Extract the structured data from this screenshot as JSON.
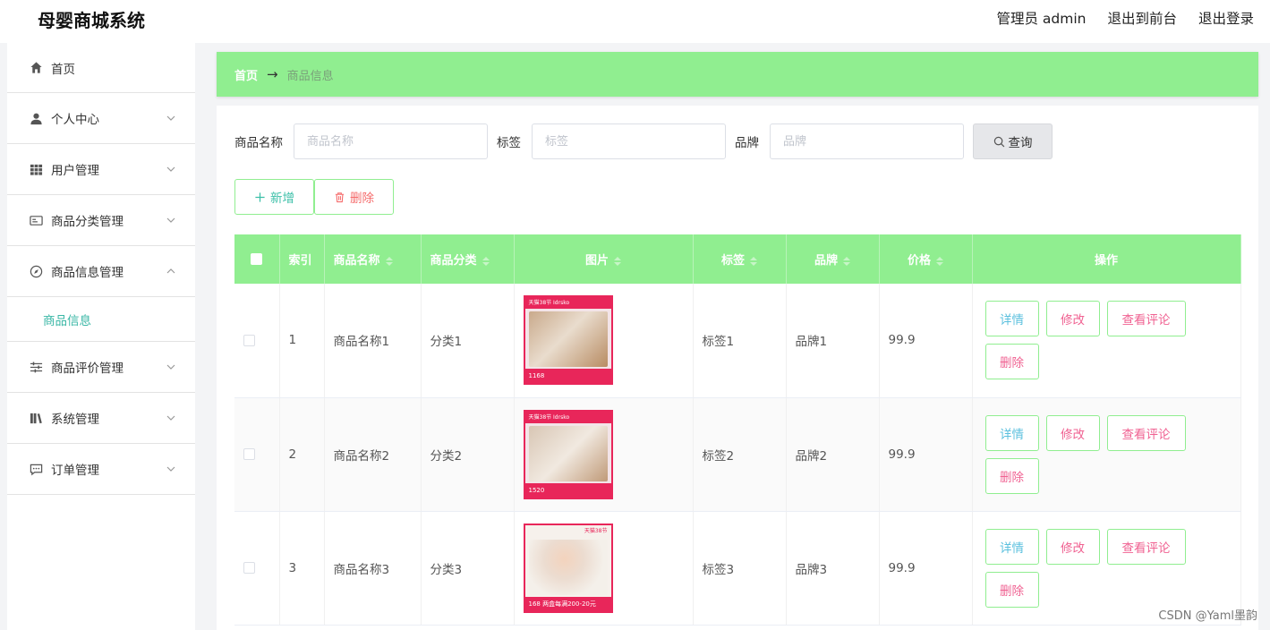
{
  "app": {
    "title": "母婴商城系统"
  },
  "header": {
    "admin": "管理员 admin",
    "to_front": "退出到前台",
    "logout": "退出登录"
  },
  "sidebar": {
    "items": [
      {
        "label": "首页",
        "icon": "home-icon"
      },
      {
        "label": "个人中心",
        "icon": "user-icon"
      },
      {
        "label": "用户管理",
        "icon": "grid-icon"
      },
      {
        "label": "商品分类管理",
        "icon": "card-icon"
      },
      {
        "label": "商品信息管理",
        "icon": "compass-icon",
        "expanded": true,
        "children": [
          {
            "label": "商品信息",
            "active": true
          }
        ]
      },
      {
        "label": "商品评价管理",
        "icon": "sliders-icon"
      },
      {
        "label": "系统管理",
        "icon": "library-icon"
      },
      {
        "label": "订单管理",
        "icon": "chat-icon"
      }
    ]
  },
  "breadcrumb": {
    "home": "首页",
    "arrow": "→",
    "current": "商品信息"
  },
  "search": {
    "name_label": "商品名称",
    "name_placeholder": "商品名称",
    "tag_label": "标签",
    "tag_placeholder": "标签",
    "brand_label": "品牌",
    "brand_placeholder": "品牌",
    "query_button": "查询"
  },
  "actions": {
    "add": "新增",
    "delete": "删除"
  },
  "table": {
    "headers": [
      "索引",
      "商品名称",
      "商品分类",
      "图片",
      "标签",
      "品牌",
      "价格",
      "操作"
    ],
    "rows": [
      {
        "index": "1",
        "name": "商品名称1",
        "category": "分类1",
        "tag": "标签1",
        "brand": "品牌1",
        "price": "99.9",
        "image": {
          "banner": "天猫38节 Idrsko",
          "caption": "1168"
        }
      },
      {
        "index": "2",
        "name": "商品名称2",
        "category": "分类2",
        "tag": "标签2",
        "brand": "品牌2",
        "price": "99.9",
        "image": {
          "banner": "天猫38节 Idrsko",
          "caption": "1520"
        }
      },
      {
        "index": "3",
        "name": "商品名称3",
        "category": "分类3",
        "tag": "标签3",
        "brand": "品牌3",
        "price": "99.9",
        "image": {
          "banner": "天猫38节",
          "caption": "168 两盒每满200-20元"
        }
      }
    ],
    "row_actions": {
      "detail": "详情",
      "edit": "修改",
      "review": "查看评论",
      "remove": "删除"
    }
  },
  "watermark": "CSDN @Yaml墨韵",
  "colors": {
    "accent": "#90ee90",
    "teal": "#3bbfa8",
    "danger": "#f56c6c",
    "pink": "#f06292",
    "image_frame": "#e8265a"
  }
}
